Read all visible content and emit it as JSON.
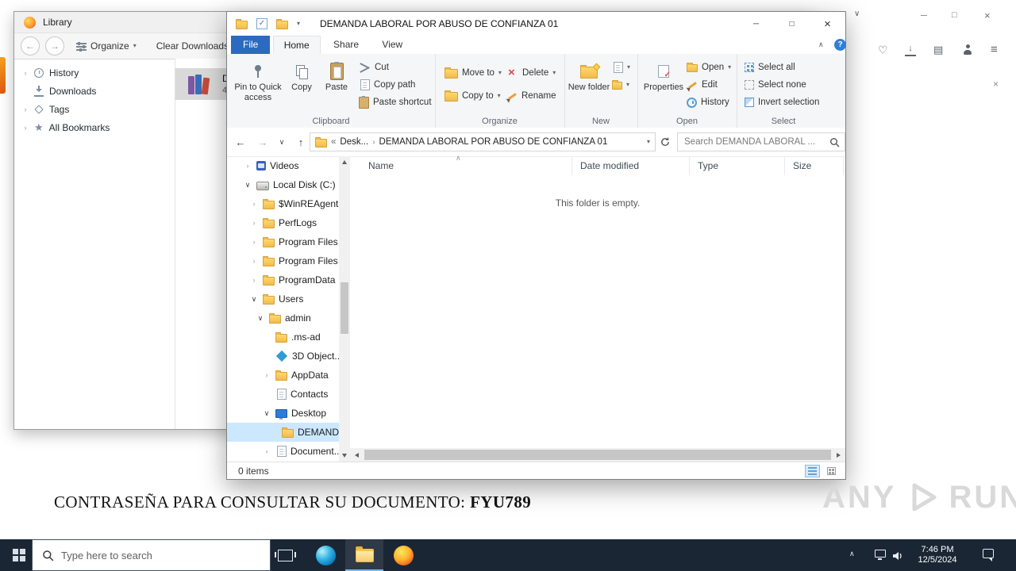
{
  "glyphs": {
    "minimize": "─",
    "maximize": "□",
    "close": "×",
    "help": "?",
    "ribbon_collapse": "∧",
    "dropdown": "▾",
    "back": "←",
    "forward": "→",
    "up": "↑",
    "overflow": "«",
    "crumb_sep": "›",
    "tree_collapsed": "›",
    "tree_expanded": "∨",
    "sort": "∧",
    "tab_chevron": "∨",
    "tray_chevron": "∧",
    "menu": "≡",
    "heart": "♡",
    "library_panes": "▤",
    "sidebar_panel": "◨",
    "download_arrow": "↓"
  },
  "firefox": {
    "page": {
      "password_label": "CONTRASEÑA PARA CONSULTAR SU DOCUMENTO: ",
      "password_value": "FYU789"
    }
  },
  "library": {
    "title": "Library",
    "toolbar": {
      "organize": "Organize",
      "clear_downloads": "Clear Downloads"
    },
    "sidebar": [
      {
        "label": "History",
        "icon": "clock",
        "expandable": true
      },
      {
        "label": "Downloads",
        "icon": "download",
        "expandable": false
      },
      {
        "label": "Tags",
        "icon": "tag",
        "expandable": true
      },
      {
        "label": "All Bookmarks",
        "icon": "star",
        "expandable": true
      }
    ],
    "download_item": {
      "name_fragment": "D",
      "detail_fragment": "4"
    }
  },
  "explorer": {
    "title": "DEMANDA LABORAL POR ABUSO DE CONFIANZA 01",
    "tabs": {
      "file": "File",
      "home": "Home",
      "share": "Share",
      "view": "View"
    },
    "ribbon": {
      "clipboard": {
        "label": "Clipboard",
        "pin": "Pin to Quick access",
        "copy": "Copy",
        "paste": "Paste",
        "cut": "Cut",
        "copy_path": "Copy path",
        "paste_shortcut": "Paste shortcut"
      },
      "organize": {
        "label": "Organize",
        "move_to": "Move to",
        "copy_to": "Copy to",
        "delete": "Delete",
        "rename": "Rename"
      },
      "new_group": {
        "label": "New",
        "new_folder": "New folder"
      },
      "open_group": {
        "label": "Open",
        "properties": "Properties",
        "open": "Open",
        "edit": "Edit",
        "history": "History"
      },
      "select_group": {
        "label": "Select",
        "select_all": "Select all",
        "select_none": "Select none",
        "invert": "Invert selection"
      }
    },
    "address": {
      "crumb_root": "Desk...",
      "crumb_current": "DEMANDA LABORAL POR ABUSO DE CONFIANZA 01",
      "search_placeholder": "Search DEMANDA LABORAL ..."
    },
    "columns": {
      "name": "Name",
      "date": "Date modified",
      "type": "Type",
      "size": "Size"
    },
    "empty_text": "This folder is empty.",
    "status": {
      "items": "0 items"
    },
    "tree": [
      {
        "label": "Videos",
        "depth": 0,
        "exp": "collapsed",
        "icon": "videos"
      },
      {
        "label": "Local Disk (C:)",
        "depth": 0,
        "exp": "expanded",
        "icon": "drive"
      },
      {
        "label": "$WinREAgent",
        "depth": 1,
        "exp": "collapsed",
        "icon": "folder"
      },
      {
        "label": "PerfLogs",
        "depth": 1,
        "exp": "collapsed",
        "icon": "folder"
      },
      {
        "label": "Program Files",
        "depth": 1,
        "exp": "collapsed",
        "icon": "folder"
      },
      {
        "label": "Program Files",
        "depth": 1,
        "exp": "collapsed",
        "icon": "folder"
      },
      {
        "label": "ProgramData",
        "depth": 1,
        "exp": "collapsed",
        "icon": "folder"
      },
      {
        "label": "Users",
        "depth": 1,
        "exp": "expanded",
        "icon": "folder"
      },
      {
        "label": "admin",
        "depth": 2,
        "exp": "expanded",
        "icon": "folder"
      },
      {
        "label": ".ms-ad",
        "depth": 3,
        "exp": "none",
        "icon": "folder"
      },
      {
        "label": "3D Object...",
        "depth": 3,
        "exp": "none",
        "icon": "cube"
      },
      {
        "label": "AppData",
        "depth": 3,
        "exp": "collapsed",
        "icon": "folder"
      },
      {
        "label": "Contacts",
        "depth": 3,
        "exp": "none",
        "icon": "contacts"
      },
      {
        "label": "Desktop",
        "depth": 3,
        "exp": "expanded",
        "icon": "desktop"
      },
      {
        "label": "DEMAND...",
        "depth": 4,
        "exp": "none",
        "icon": "folder",
        "selected": true
      },
      {
        "label": "Document...",
        "depth": 3,
        "exp": "collapsed",
        "icon": "documents"
      }
    ]
  },
  "watermark": {
    "any": "ANY",
    "run": "RUN"
  },
  "taskbar": {
    "search_placeholder": "Type here to search",
    "clock": {
      "time": "7:46 PM",
      "date": "12/5/2024"
    }
  }
}
